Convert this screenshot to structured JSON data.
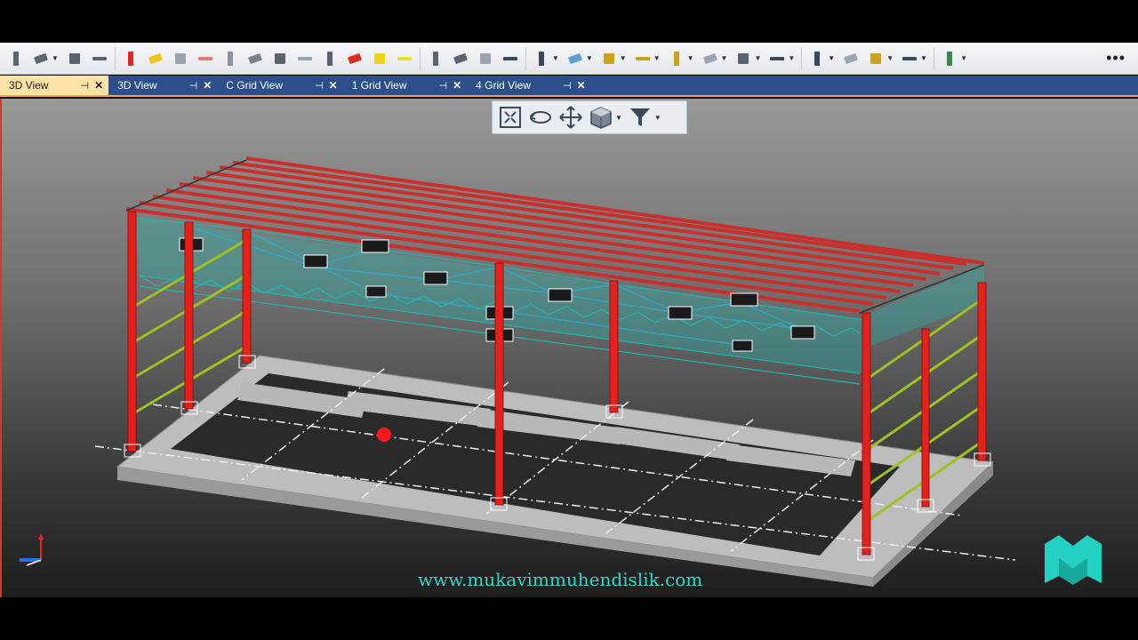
{
  "tabs": [
    {
      "label": "3D View",
      "active": true
    },
    {
      "label": "3D View",
      "active": false
    },
    {
      "label": "C Grid View",
      "active": false
    },
    {
      "label": "1 Grid View",
      "active": false
    },
    {
      "label": "4 Grid View",
      "active": false
    }
  ],
  "tab_icons": {
    "pin": "⊣",
    "close": "✕"
  },
  "toolbar": {
    "more": "•••",
    "icons": [
      "column-icon",
      "filter-select-icon",
      "dimension-icon",
      "angle-icon",
      "red-column-icon",
      "yellow-beam-icon",
      "brace-icon",
      "red-brace-icon",
      "purlin-icon",
      "pipe-icon",
      "slab-icon",
      "girt-icon",
      "plate-icon",
      "red-plate-icon",
      "yellow-column-icon",
      "yellow-plate-icon",
      "connect-icon",
      "rotate-icon",
      "hide-icon",
      "fit-icon",
      "snap-icon",
      "line-icon",
      "hatch-icon",
      "diagonal-icon",
      "pen-icon",
      "dots-icon",
      "wall-icon",
      "view-icon",
      "grid-icon",
      "measure-icon",
      "panel-icon",
      "window-icon",
      "monitor-icon"
    ]
  },
  "navbar": {
    "icons": [
      "zoom-extents-icon",
      "orbit-icon",
      "pan-icon",
      "view-cube-icon",
      "filter-icon"
    ]
  },
  "watermark": "www.mukavimmuhendislik.com",
  "colors": {
    "accent": "#f5a623",
    "tab_bar": "#2c4f8c",
    "column": "#e8201c",
    "truss": "#1fb7b0",
    "girt": "#9dc121",
    "watermark": "#35d6c8"
  }
}
